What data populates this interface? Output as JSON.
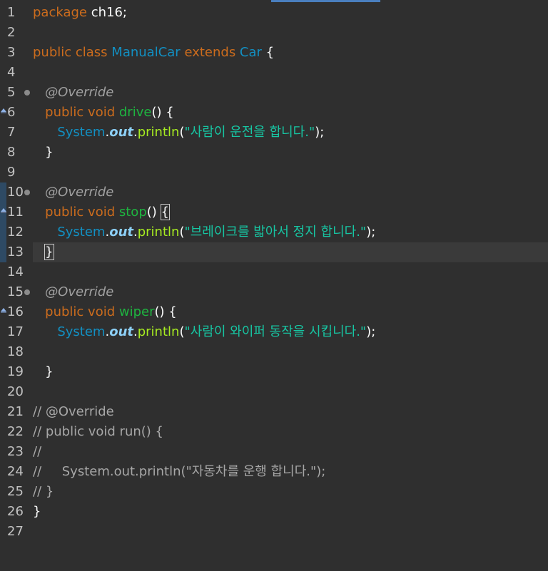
{
  "lines": [
    {
      "n": "1",
      "t": [
        [
          "kw",
          "package"
        ],
        [
          "punc",
          " ch16;"
        ]
      ]
    },
    {
      "n": "2",
      "t": []
    },
    {
      "n": "3",
      "t": [
        [
          "kw",
          "public class "
        ],
        [
          "type",
          "ManualCar"
        ],
        [
          "kw",
          " extends "
        ],
        [
          "type",
          "Car"
        ],
        [
          "punc",
          " {"
        ]
      ]
    },
    {
      "n": "4",
      "t": []
    },
    {
      "n": "5",
      "fold": true,
      "t": [
        [
          "punc",
          "   "
        ],
        [
          "anno",
          "@Override"
        ]
      ]
    },
    {
      "n": "6",
      "override": true,
      "t": [
        [
          "punc",
          "   "
        ],
        [
          "kw",
          "public void "
        ],
        [
          "method2",
          "drive"
        ],
        [
          "punc",
          "() {"
        ]
      ]
    },
    {
      "n": "7",
      "t": [
        [
          "punc",
          "      "
        ],
        [
          "type",
          "System"
        ],
        [
          "punc",
          "."
        ],
        [
          "field",
          "out"
        ],
        [
          "punc",
          "."
        ],
        [
          "method",
          "println"
        ],
        [
          "punc",
          "("
        ],
        [
          "str",
          "\"사람이 운전을 합니다.\""
        ],
        [
          "punc",
          ");"
        ]
      ]
    },
    {
      "n": "8",
      "t": [
        [
          "punc",
          "   }"
        ]
      ]
    },
    {
      "n": "9",
      "t": []
    },
    {
      "n": "10",
      "fold": true,
      "changed": true,
      "t": [
        [
          "punc",
          "   "
        ],
        [
          "anno",
          "@Override"
        ]
      ]
    },
    {
      "n": "11",
      "override": true,
      "changed": true,
      "t": [
        [
          "punc",
          "   "
        ],
        [
          "kw",
          "public void "
        ],
        [
          "method2",
          "stop"
        ],
        [
          "punc",
          "() "
        ],
        [
          "box",
          "{"
        ]
      ]
    },
    {
      "n": "12",
      "changed": true,
      "t": [
        [
          "punc",
          "      "
        ],
        [
          "type",
          "System"
        ],
        [
          "punc",
          "."
        ],
        [
          "field",
          "out"
        ],
        [
          "punc",
          "."
        ],
        [
          "method",
          "println"
        ],
        [
          "punc",
          "("
        ],
        [
          "str",
          "\"브레이크를 밟아서 정지 합니다.\""
        ],
        [
          "punc",
          ");"
        ]
      ]
    },
    {
      "n": "13",
      "changed": true,
      "current": true,
      "t": [
        [
          "punc",
          "   "
        ],
        [
          "box",
          "}"
        ],
        [
          "caret",
          ""
        ]
      ]
    },
    {
      "n": "14",
      "t": []
    },
    {
      "n": "15",
      "fold": true,
      "t": [
        [
          "punc",
          "   "
        ],
        [
          "anno",
          "@Override"
        ]
      ]
    },
    {
      "n": "16",
      "override": true,
      "t": [
        [
          "punc",
          "   "
        ],
        [
          "kw",
          "public void "
        ],
        [
          "method2",
          "wiper"
        ],
        [
          "punc",
          "() {"
        ]
      ]
    },
    {
      "n": "17",
      "t": [
        [
          "punc",
          "      "
        ],
        [
          "type",
          "System"
        ],
        [
          "punc",
          "."
        ],
        [
          "field",
          "out"
        ],
        [
          "punc",
          "."
        ],
        [
          "method",
          "println"
        ],
        [
          "punc",
          "("
        ],
        [
          "str",
          "\"사람이 와이퍼 동작을 시킵니다.\""
        ],
        [
          "punc",
          ");"
        ]
      ]
    },
    {
      "n": "18",
      "t": []
    },
    {
      "n": "19",
      "t": [
        [
          "punc",
          "   }"
        ]
      ]
    },
    {
      "n": "20",
      "t": []
    },
    {
      "n": "21",
      "t": [
        [
          "comment",
          "// @Override"
        ]
      ]
    },
    {
      "n": "22",
      "t": [
        [
          "comment",
          "// public void run() {"
        ]
      ]
    },
    {
      "n": "23",
      "t": [
        [
          "comment",
          "//"
        ]
      ]
    },
    {
      "n": "24",
      "t": [
        [
          "comment",
          "//     System.out.println(\"자동차를 운행 합니다.\");"
        ]
      ]
    },
    {
      "n": "25",
      "t": [
        [
          "comment",
          "// }"
        ]
      ]
    },
    {
      "n": "26",
      "t": [
        [
          "punc",
          "}"
        ]
      ]
    },
    {
      "n": "27",
      "t": []
    }
  ]
}
